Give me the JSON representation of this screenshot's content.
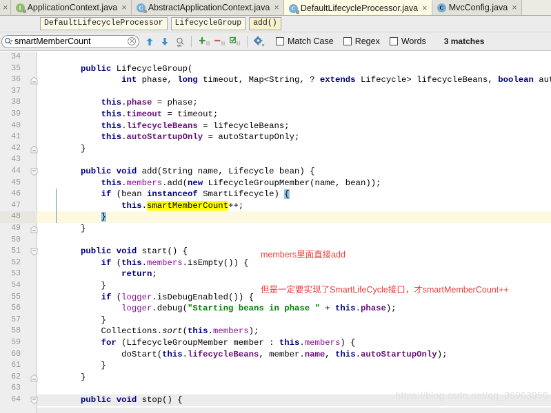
{
  "window": {
    "app": "IntelliJ IDEA",
    "active_file": "DefaultLifecycleProcessor.java"
  },
  "tabs": [
    {
      "label": "ApplicationContext.java",
      "icon": "interface-icon",
      "icon_kind": "iface",
      "active": false,
      "close": "×"
    },
    {
      "label": "AbstractApplicationContext.java",
      "icon": "class-icon",
      "icon_kind": "cls",
      "active": false,
      "close": "×"
    },
    {
      "label": "DefaultLifecycleProcessor.java",
      "icon": "class-icon",
      "icon_kind": "cls",
      "active": true,
      "close": "×"
    },
    {
      "label": "MvcConfig.java",
      "icon": "class-icon",
      "icon_kind": "cls-plain",
      "active": false,
      "close": "×"
    }
  ],
  "tab_edge_close": "×",
  "breadcrumb": {
    "name": "breadcrumb",
    "items": [
      {
        "label": "DefaultLifecycleProcessor",
        "highlight": false
      },
      {
        "label": "LifecycleGroup",
        "highlight": false
      },
      {
        "label": "add()",
        "highlight": true
      }
    ]
  },
  "search": {
    "value": "smartMemberCount",
    "placeholder": "Search",
    "buttons": [
      {
        "name": "find-previous-button",
        "icon": "arrow-up-icon"
      },
      {
        "name": "find-next-button",
        "icon": "arrow-down-icon"
      },
      {
        "name": "find-all-button",
        "icon": "magnifier-list-icon"
      },
      {
        "name": "select-all-occurrences-button",
        "icon": "plus-green-icon"
      },
      {
        "name": "exclude-occurrence-button",
        "icon": "minus-red-icon"
      },
      {
        "name": "preview-occurrence-button",
        "icon": "checkbox-green-icon"
      },
      {
        "name": "filter-settings-button",
        "icon": "gear-icon"
      }
    ],
    "options": [
      {
        "label": "Match Case",
        "checked": false
      },
      {
        "label": "Regex",
        "checked": false
      },
      {
        "label": "Words",
        "checked": false
      }
    ],
    "result_text": "3 matches"
  },
  "editor": {
    "first_visible_line": 33,
    "caret_line": 48,
    "annotation": {
      "line1": "members里面直接add",
      "line2": "但是一定要实现了SmartLifeCycle接口，才smartMemberCount++"
    },
    "watermark": "https://blog.csdn.net/qq_36963950",
    "lines": [
      {
        "n": 34,
        "tokens": []
      },
      {
        "n": 35,
        "tokens": [
          {
            "t": "        ",
            "c": "plain"
          },
          {
            "t": "public",
            "c": "kw"
          },
          {
            "t": " LifecycleGroup(",
            "c": "plain"
          }
        ]
      },
      {
        "n": 36,
        "fold": "end",
        "tokens": [
          {
            "t": "                ",
            "c": "plain"
          },
          {
            "t": "int",
            "c": "kw"
          },
          {
            "t": " phase, ",
            "c": "plain"
          },
          {
            "t": "long",
            "c": "kw"
          },
          {
            "t": " timeout, Map<String, ? ",
            "c": "plain"
          },
          {
            "t": "extends",
            "c": "kw"
          },
          {
            "t": " Lifecycle> lifecycleBeans, ",
            "c": "plain"
          },
          {
            "t": "boolean",
            "c": "kw"
          },
          {
            "t": " autoSta",
            "c": "plain"
          }
        ]
      },
      {
        "n": 37,
        "tokens": []
      },
      {
        "n": 38,
        "tokens": [
          {
            "t": "            ",
            "c": "plain"
          },
          {
            "t": "this",
            "c": "kw"
          },
          {
            "t": ".",
            "c": "plain"
          },
          {
            "t": "phase",
            "c": "fld"
          },
          {
            "t": " = phase;",
            "c": "plain"
          }
        ]
      },
      {
        "n": 39,
        "tokens": [
          {
            "t": "            ",
            "c": "plain"
          },
          {
            "t": "this",
            "c": "kw"
          },
          {
            "t": ".",
            "c": "plain"
          },
          {
            "t": "timeout",
            "c": "fld"
          },
          {
            "t": " = timeout;",
            "c": "plain"
          }
        ]
      },
      {
        "n": 40,
        "tokens": [
          {
            "t": "            ",
            "c": "plain"
          },
          {
            "t": "this",
            "c": "kw"
          },
          {
            "t": ".",
            "c": "plain"
          },
          {
            "t": "lifecycleBeans",
            "c": "fld"
          },
          {
            "t": " = lifecycleBeans;",
            "c": "plain"
          }
        ]
      },
      {
        "n": 41,
        "tokens": [
          {
            "t": "            ",
            "c": "plain"
          },
          {
            "t": "this",
            "c": "kw"
          },
          {
            "t": ".",
            "c": "plain"
          },
          {
            "t": "autoStartupOnly",
            "c": "fld"
          },
          {
            "t": " = autoStartupOnly;",
            "c": "plain"
          }
        ]
      },
      {
        "n": 42,
        "fold": "end",
        "tokens": [
          {
            "t": "        }",
            "c": "plain"
          }
        ]
      },
      {
        "n": 43,
        "tokens": []
      },
      {
        "n": 44,
        "fold": "start",
        "tokens": [
          {
            "t": "        ",
            "c": "plain"
          },
          {
            "t": "public",
            "c": "kw"
          },
          {
            "t": " ",
            "c": "plain"
          },
          {
            "t": "void",
            "c": "kw"
          },
          {
            "t": " add(String name, Lifecycle bean) {",
            "c": "plain"
          }
        ]
      },
      {
        "n": 45,
        "tokens": [
          {
            "t": "            ",
            "c": "plain"
          },
          {
            "t": "this",
            "c": "kw"
          },
          {
            "t": ".",
            "c": "plain"
          },
          {
            "t": "members",
            "c": "fldn"
          },
          {
            "t": ".add(",
            "c": "plain"
          },
          {
            "t": "new",
            "c": "kw"
          },
          {
            "t": " LifecycleGroupMember(name, bean));",
            "c": "plain"
          }
        ]
      },
      {
        "n": 46,
        "tokens": [
          {
            "t": "            ",
            "c": "plain"
          },
          {
            "t": "if",
            "c": "kw"
          },
          {
            "t": " (bean ",
            "c": "plain"
          },
          {
            "t": "instanceof",
            "c": "kw"
          },
          {
            "t": " SmartLifecycle) ",
            "c": "plain"
          },
          {
            "t": "{",
            "c": "brc"
          }
        ]
      },
      {
        "n": 47,
        "tokens": [
          {
            "t": "                ",
            "c": "plain"
          },
          {
            "t": "this",
            "c": "kw"
          },
          {
            "t": ".",
            "c": "plain"
          },
          {
            "t": "smartMemberCount",
            "c": "hl"
          },
          {
            "t": "++;",
            "c": "plain"
          }
        ]
      },
      {
        "n": 48,
        "caret": true,
        "tokens": [
          {
            "t": "            ",
            "c": "plain"
          },
          {
            "t": "}",
            "c": "brc"
          }
        ]
      },
      {
        "n": 49,
        "fold": "end",
        "tokens": [
          {
            "t": "        }",
            "c": "plain"
          }
        ]
      },
      {
        "n": 50,
        "tokens": []
      },
      {
        "n": 51,
        "fold": "start",
        "tokens": [
          {
            "t": "        ",
            "c": "plain"
          },
          {
            "t": "public",
            "c": "kw"
          },
          {
            "t": " ",
            "c": "plain"
          },
          {
            "t": "void",
            "c": "kw"
          },
          {
            "t": " start() {",
            "c": "plain"
          }
        ]
      },
      {
        "n": 52,
        "tokens": [
          {
            "t": "            ",
            "c": "plain"
          },
          {
            "t": "if",
            "c": "kw"
          },
          {
            "t": " (",
            "c": "plain"
          },
          {
            "t": "this",
            "c": "kw"
          },
          {
            "t": ".",
            "c": "plain"
          },
          {
            "t": "members",
            "c": "fldn"
          },
          {
            "t": ".isEmpty()) {",
            "c": "plain"
          }
        ]
      },
      {
        "n": 53,
        "tokens": [
          {
            "t": "                ",
            "c": "plain"
          },
          {
            "t": "return",
            "c": "kw"
          },
          {
            "t": ";",
            "c": "plain"
          }
        ]
      },
      {
        "n": 54,
        "tokens": [
          {
            "t": "            }",
            "c": "plain"
          }
        ]
      },
      {
        "n": 55,
        "tokens": [
          {
            "t": "            ",
            "c": "plain"
          },
          {
            "t": "if",
            "c": "kw"
          },
          {
            "t": " (",
            "c": "plain"
          },
          {
            "t": "logger",
            "c": "fldn"
          },
          {
            "t": ".isDebugEnabled()) {",
            "c": "plain"
          }
        ]
      },
      {
        "n": 56,
        "tokens": [
          {
            "t": "                ",
            "c": "plain"
          },
          {
            "t": "logger",
            "c": "fldn"
          },
          {
            "t": ".debug(",
            "c": "plain"
          },
          {
            "t": "\"Starting beans in phase \"",
            "c": "str"
          },
          {
            "t": " + ",
            "c": "plain"
          },
          {
            "t": "this",
            "c": "kw"
          },
          {
            "t": ".",
            "c": "plain"
          },
          {
            "t": "phase",
            "c": "fld"
          },
          {
            "t": ");",
            "c": "plain"
          }
        ]
      },
      {
        "n": 57,
        "tokens": [
          {
            "t": "            }",
            "c": "plain"
          }
        ]
      },
      {
        "n": 58,
        "tokens": [
          {
            "t": "            Collections.",
            "c": "plain"
          },
          {
            "t": "sort",
            "c": "sta"
          },
          {
            "t": "(",
            "c": "plain"
          },
          {
            "t": "this",
            "c": "kw"
          },
          {
            "t": ".",
            "c": "plain"
          },
          {
            "t": "members",
            "c": "fldn"
          },
          {
            "t": ");",
            "c": "plain"
          }
        ]
      },
      {
        "n": 59,
        "tokens": [
          {
            "t": "            ",
            "c": "plain"
          },
          {
            "t": "for",
            "c": "kw"
          },
          {
            "t": " (LifecycleGroupMember member : ",
            "c": "plain"
          },
          {
            "t": "this",
            "c": "kw"
          },
          {
            "t": ".",
            "c": "plain"
          },
          {
            "t": "members",
            "c": "fldn"
          },
          {
            "t": ") {",
            "c": "plain"
          }
        ]
      },
      {
        "n": 60,
        "tokens": [
          {
            "t": "                doStart(",
            "c": "plain"
          },
          {
            "t": "this",
            "c": "kw"
          },
          {
            "t": ".",
            "c": "plain"
          },
          {
            "t": "lifecycleBeans",
            "c": "fld"
          },
          {
            "t": ", member.",
            "c": "plain"
          },
          {
            "t": "name",
            "c": "fld"
          },
          {
            "t": ", ",
            "c": "plain"
          },
          {
            "t": "this",
            "c": "kw"
          },
          {
            "t": ".",
            "c": "plain"
          },
          {
            "t": "autoStartupOnly",
            "c": "fld"
          },
          {
            "t": ");",
            "c": "plain"
          }
        ]
      },
      {
        "n": 61,
        "tokens": [
          {
            "t": "            }",
            "c": "plain"
          }
        ]
      },
      {
        "n": 62,
        "fold": "end",
        "tokens": [
          {
            "t": "        }",
            "c": "plain"
          }
        ]
      },
      {
        "n": 63,
        "tokens": []
      },
      {
        "n": 64,
        "shaded": true,
        "fold": "start",
        "tokens": [
          {
            "t": "        ",
            "c": "plain"
          },
          {
            "t": "public",
            "c": "kw"
          },
          {
            "t": " ",
            "c": "plain"
          },
          {
            "t": "void",
            "c": "kw"
          },
          {
            "t": " stop() {",
            "c": "plain"
          }
        ]
      }
    ]
  }
}
